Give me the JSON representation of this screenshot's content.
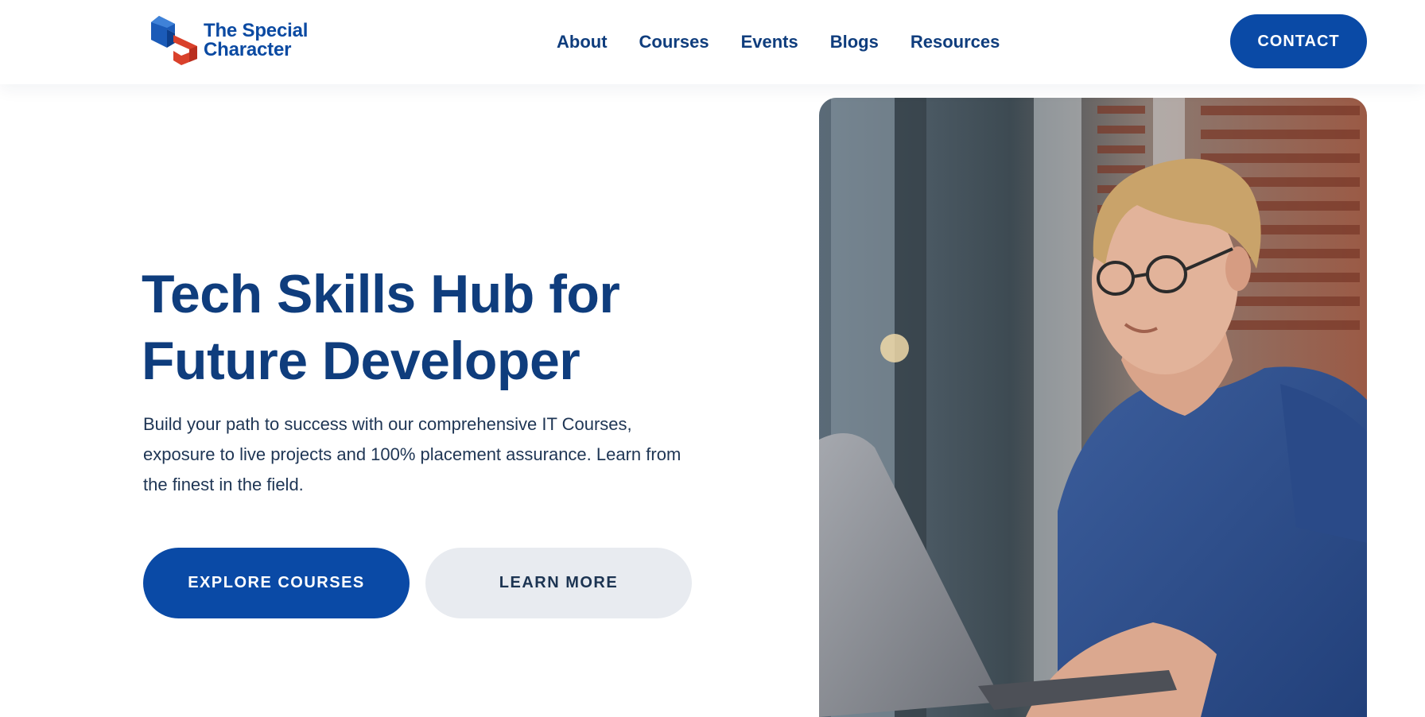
{
  "brand": {
    "name_line1": "The Special",
    "name_line2": "Character",
    "colors": {
      "primary": "#0a4aa6",
      "heading": "#0f3d7d",
      "logo_red": "#d9412b",
      "secondary_bg": "#e8ebf0"
    }
  },
  "nav": {
    "items": [
      {
        "label": "About"
      },
      {
        "label": "Courses"
      },
      {
        "label": "Events"
      },
      {
        "label": "Blogs"
      },
      {
        "label": "Resources"
      }
    ],
    "contact_label": "CONTACT"
  },
  "hero": {
    "title_line1": "Tech Skills Hub for",
    "title_line2": "Future Developer",
    "description": "Build your path to success with our comprehensive IT Courses, exposure to live projects and 100% placement assurance. Learn from the finest in the field.",
    "primary_button": "EXPLORE COURSES",
    "secondary_button": "LEARN MORE"
  }
}
